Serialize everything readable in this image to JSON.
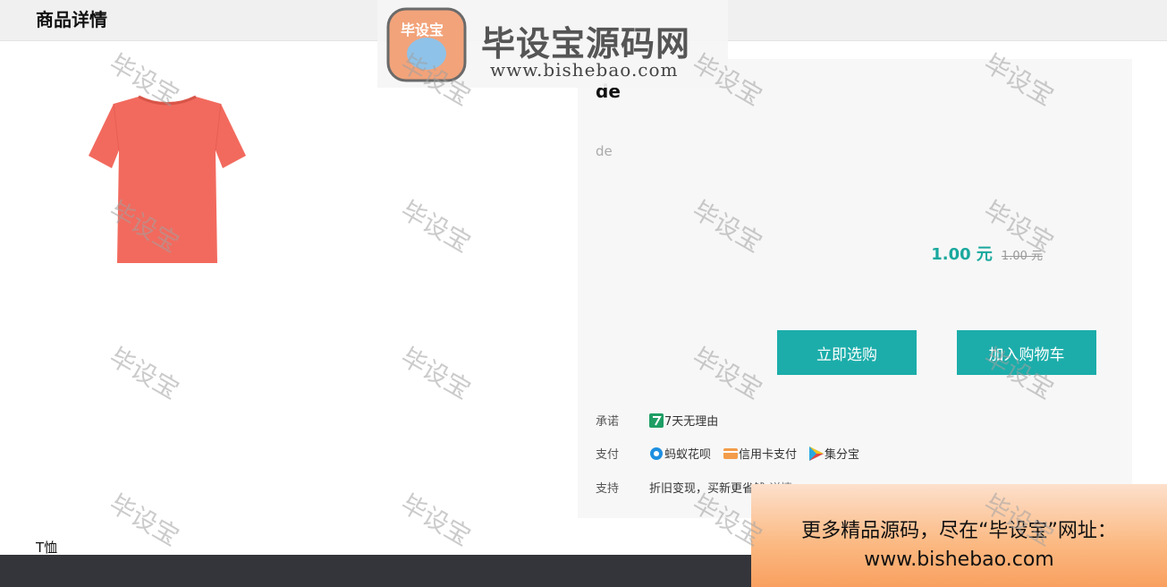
{
  "header": {
    "title": "商品详情"
  },
  "product": {
    "name": "de",
    "description": "de",
    "price": "1.00 元",
    "original_price": "1.00 元",
    "category": "T恤"
  },
  "buttons": {
    "buy_now": "立即选购",
    "add_to_cart": "加入购物车"
  },
  "services": {
    "promise": {
      "label": "承诺",
      "items": [
        "7天无理由"
      ]
    },
    "payment": {
      "label": "支付",
      "items": [
        "蚂蚁花呗",
        "信用卡支付",
        "集分宝"
      ]
    },
    "support": {
      "label": "支持",
      "items": [
        "折旧变现，买新更省钱"
      ],
      "link": "详情"
    }
  },
  "logo": {
    "badge": "毕设宝",
    "name": "毕设宝源码网",
    "url": "www.bishebao.com"
  },
  "ad": {
    "line1": "更多精品源码，尽在“毕设宝”网址：",
    "line2": "www.bishebao.com"
  },
  "watermark": "毕设宝",
  "colors": {
    "accent": "#1cadaa",
    "price": "#1aa89e",
    "shirt": "#f26a5e",
    "footer": "#34353a"
  }
}
